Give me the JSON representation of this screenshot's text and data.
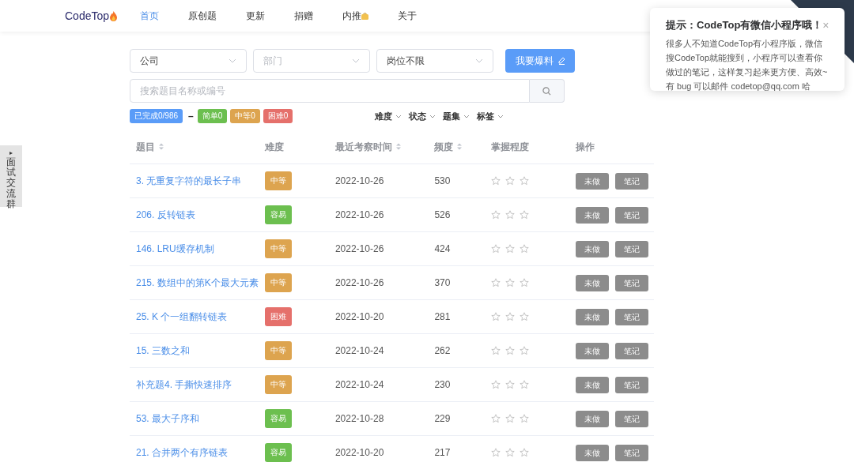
{
  "nav": {
    "brand": "CodeTop",
    "items": [
      {
        "label": "首页",
        "selected": true
      },
      {
        "label": "原创题",
        "selected": false
      },
      {
        "label": "更新",
        "selected": false
      },
      {
        "label": "捐赠",
        "selected": false
      },
      {
        "label": "内推",
        "selected": false,
        "badge": true
      },
      {
        "label": "关于",
        "selected": false
      }
    ]
  },
  "side_tab": {
    "arrow": "▸",
    "label": "面试交流群"
  },
  "filters": [
    {
      "text": "公司",
      "disabled": false
    },
    {
      "text": "部门",
      "disabled": true
    },
    {
      "text": "岗位不限",
      "disabled": false
    }
  ],
  "report_button": "我要爆料",
  "search": {
    "placeholder": "搜索题目名称或编号"
  },
  "progress": {
    "done": "已完成0/986",
    "separator": "–",
    "counts": [
      {
        "label": "简单0",
        "color": "#6cbf4f"
      },
      {
        "label": "中等0",
        "color": "#dda44f"
      },
      {
        "label": "困难0",
        "color": "#e5706b"
      }
    ]
  },
  "column_filters": [
    "难度",
    "状态",
    "题集",
    "标签"
  ],
  "table": {
    "columns": [
      {
        "label": "题目",
        "sortable": true
      },
      {
        "label": "难度",
        "sortable": false
      },
      {
        "label": "最近考察时间",
        "sortable": true
      },
      {
        "label": "频度",
        "sortable": true
      },
      {
        "label": "掌握程度",
        "sortable": false
      },
      {
        "label": "操作",
        "sortable": false
      }
    ],
    "rows": [
      {
        "title": "3. 无重复字符的最长子串",
        "difficulty": {
          "label": "中等",
          "kind": "medium"
        },
        "date": "2022-10-26",
        "frequency": "530",
        "stars": 0,
        "actions": [
          "未做",
          "笔记"
        ]
      },
      {
        "title": "206. 反转链表",
        "difficulty": {
          "label": "容易",
          "kind": "easy"
        },
        "date": "2022-10-26",
        "frequency": "526",
        "stars": 0,
        "actions": [
          "未做",
          "笔记"
        ]
      },
      {
        "title": "146. LRU缓存机制",
        "difficulty": {
          "label": "中等",
          "kind": "medium"
        },
        "date": "2022-10-26",
        "frequency": "424",
        "stars": 0,
        "actions": [
          "未做",
          "笔记"
        ]
      },
      {
        "title": "215. 数组中的第K个最大元素",
        "difficulty": {
          "label": "中等",
          "kind": "medium"
        },
        "date": "2022-10-26",
        "frequency": "370",
        "stars": 0,
        "actions": [
          "未做",
          "笔记"
        ]
      },
      {
        "title": "25. K 个一组翻转链表",
        "difficulty": {
          "label": "困难",
          "kind": "hard"
        },
        "date": "2022-10-20",
        "frequency": "281",
        "stars": 0,
        "actions": [
          "未做",
          "笔记"
        ]
      },
      {
        "title": "15. 三数之和",
        "difficulty": {
          "label": "中等",
          "kind": "medium"
        },
        "date": "2022-10-24",
        "frequency": "262",
        "stars": 0,
        "actions": [
          "未做",
          "笔记"
        ]
      },
      {
        "title": "补充题4. 手撕快速排序",
        "difficulty": {
          "label": "中等",
          "kind": "medium"
        },
        "date": "2022-10-24",
        "frequency": "230",
        "stars": 0,
        "actions": [
          "未做",
          "笔记"
        ]
      },
      {
        "title": "53. 最大子序和",
        "difficulty": {
          "label": "容易",
          "kind": "easy"
        },
        "date": "2022-10-28",
        "frequency": "229",
        "stars": 0,
        "actions": [
          "未做",
          "笔记"
        ]
      },
      {
        "title": "21. 合并两个有序链表",
        "difficulty": {
          "label": "容易",
          "kind": "easy"
        },
        "date": "2022-10-20",
        "frequency": "217",
        "stars": 0,
        "actions": [
          "未做",
          "笔记"
        ]
      }
    ]
  },
  "notification": {
    "title": "提示：CodeTop有微信小程序哦！",
    "close": "×",
    "message": "很多人不知道CodeTop有小程序版，微信搜CodeTop就能搜到，小程序可以查看你做过的笔记，这样复习起来更方便、高效~有 bug 可以邮件 codetop@qq.com 哈"
  }
}
